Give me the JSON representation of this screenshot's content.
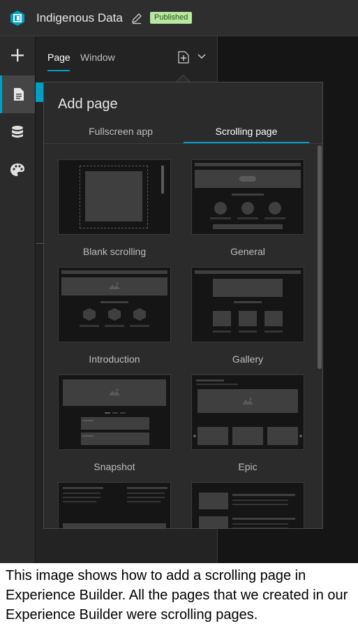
{
  "app": {
    "title": "Indigenous Data",
    "status_badge": "Published"
  },
  "panel": {
    "tabs": [
      {
        "label": "Page"
      },
      {
        "label": "Window"
      }
    ]
  },
  "popover": {
    "title": "Add page",
    "tabs": [
      {
        "label": "Fullscreen app"
      },
      {
        "label": "Scrolling page"
      }
    ],
    "templates": [
      {
        "label": "Blank scrolling"
      },
      {
        "label": "General"
      },
      {
        "label": "Introduction"
      },
      {
        "label": "Gallery"
      },
      {
        "label": "Snapshot"
      },
      {
        "label": "Epic"
      }
    ]
  },
  "caption": "This image shows how to add a scrolling page in Experience Builder.  All the pages that we created in our Experience Builder were scrolling pages.",
  "colors": {
    "accent": "#00a0c6",
    "badge_bg": "#b9e6a0"
  }
}
